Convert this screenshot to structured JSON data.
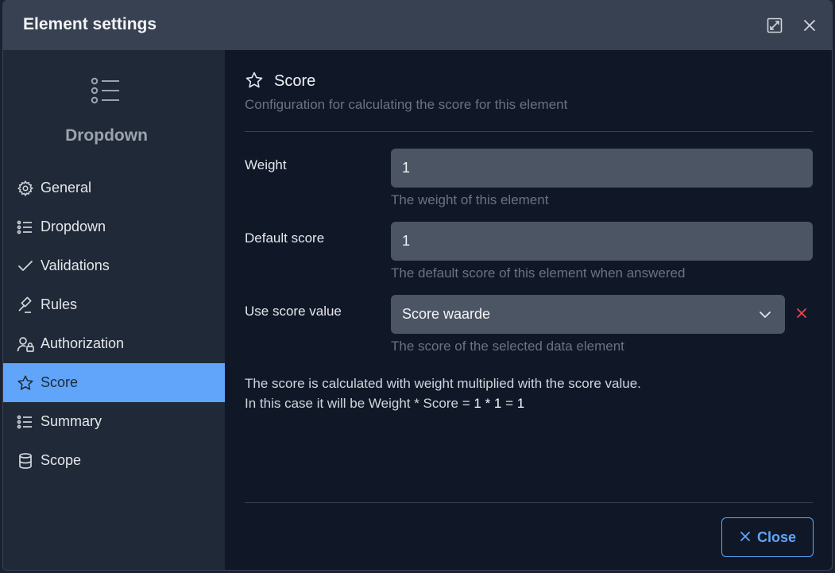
{
  "dialog": {
    "title": "Element settings",
    "icons": {
      "expand": "expand-icon",
      "close": "close-icon"
    }
  },
  "sidebar": {
    "element_icon": "list-icon",
    "element_type": "Dropdown",
    "items": [
      {
        "label": "General",
        "icon": "gear-icon",
        "active": false
      },
      {
        "label": "Dropdown",
        "icon": "list-icon",
        "active": false
      },
      {
        "label": "Validations",
        "icon": "check-icon",
        "active": false
      },
      {
        "label": "Rules",
        "icon": "gavel-icon",
        "active": false
      },
      {
        "label": "Authorization",
        "icon": "user-lock-icon",
        "active": false
      },
      {
        "label": "Score",
        "icon": "star-icon",
        "active": true
      },
      {
        "label": "Summary",
        "icon": "list-icon",
        "active": false
      },
      {
        "label": "Scope",
        "icon": "database-icon",
        "active": false
      }
    ]
  },
  "section": {
    "title": "Score",
    "description": "Configuration for calculating the score for this element"
  },
  "fields": {
    "weight": {
      "label": "Weight",
      "value": "1",
      "help": "The weight of this element"
    },
    "default_score": {
      "label": "Default score",
      "value": "1",
      "help": "The default score of this element when answered"
    },
    "use_score_value": {
      "label": "Use score value",
      "value": "Score waarde",
      "help": "The score of the selected data element"
    }
  },
  "info": {
    "line1": "The score is calculated with weight multiplied with the score value.",
    "line2_prefix": "In this case it will be Weight * Score = ",
    "weight": "1",
    "operator": "*",
    "score": "1",
    "equals": "=",
    "result": "1"
  },
  "footer": {
    "close_label": "Close"
  },
  "colors": {
    "accent": "#60a5fa",
    "danger": "#ef4444",
    "panel": "#1f2937",
    "background": "#101828"
  }
}
